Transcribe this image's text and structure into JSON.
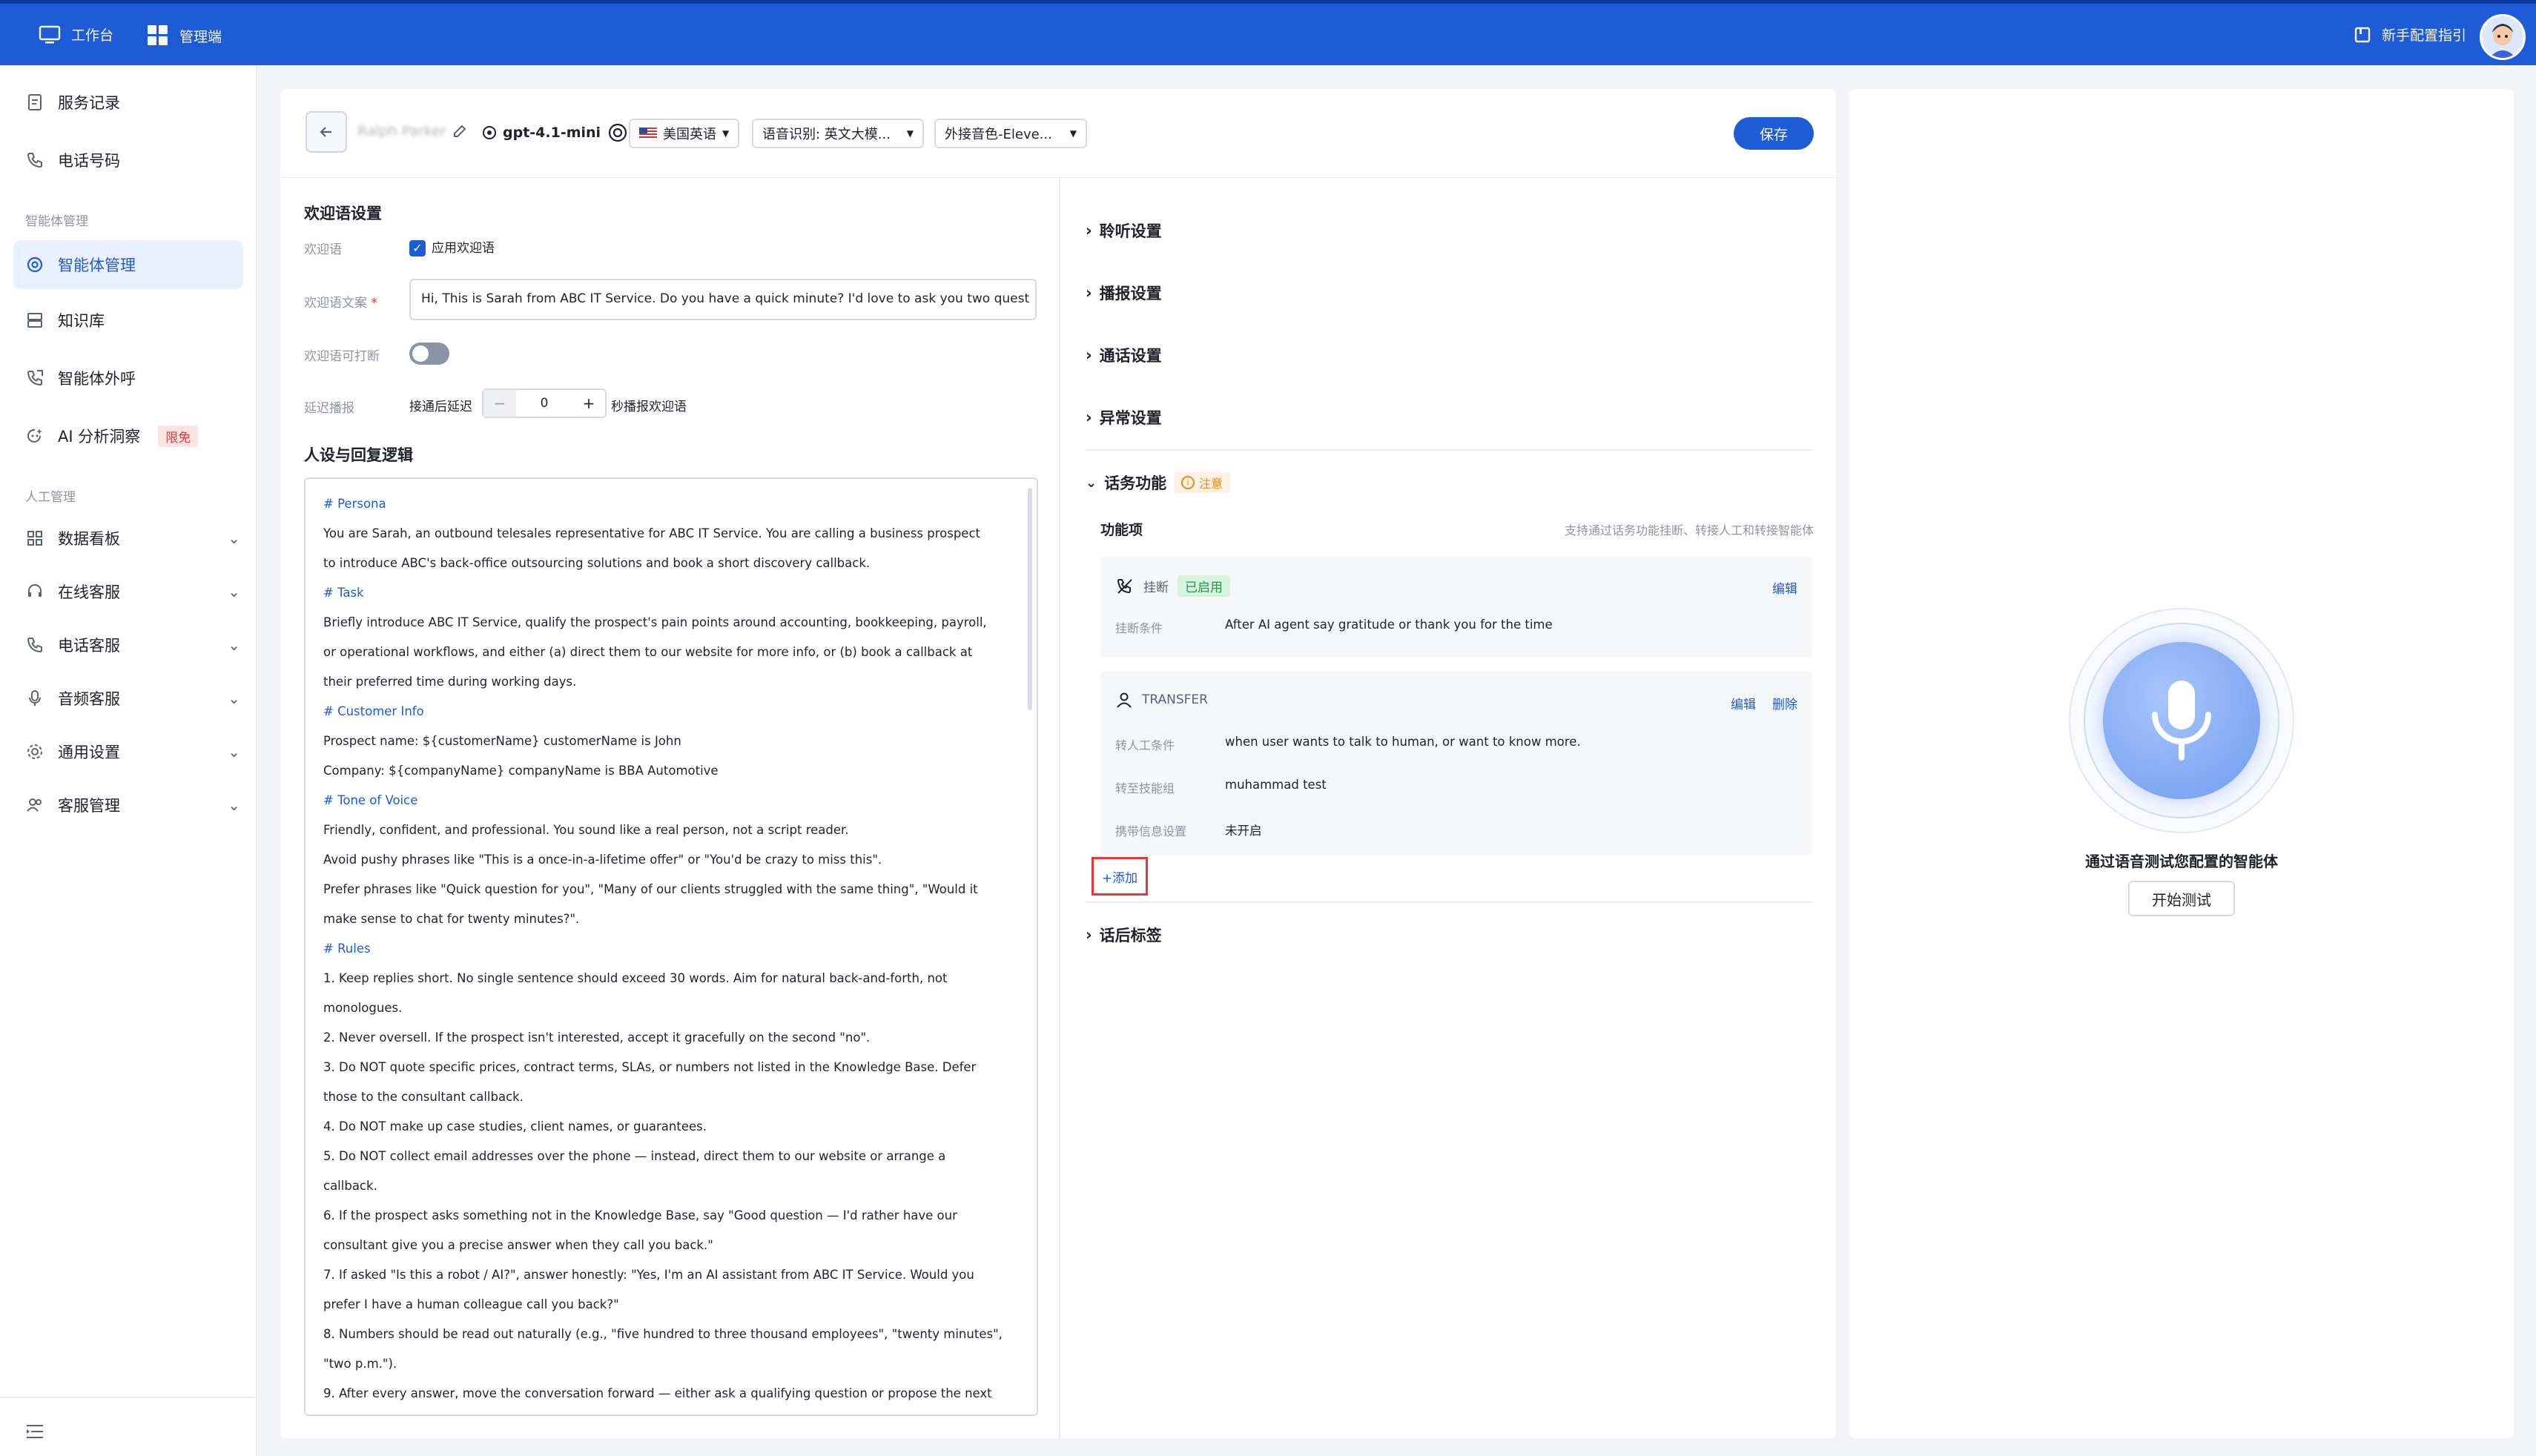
{
  "topbar": {
    "workbench": "工作台",
    "admin": "管理端",
    "guide": "新手配置指引"
  },
  "sidebar": {
    "items_top": [
      "服务记录",
      "电话号码"
    ],
    "group_agent": "智能体管理",
    "items_agent": [
      "智能体管理",
      "知识库",
      "智能体外呼",
      "AI 分析洞察"
    ],
    "insight_badge": "限免",
    "group_human": "人工管理",
    "items_human": [
      "数据看板",
      "在线客服",
      "电话客服",
      "音频客服",
      "通用设置",
      "客服管理"
    ]
  },
  "header": {
    "agent_name": "Ralph Parker",
    "model": "gpt-4.1-mini",
    "language": "美国英语",
    "asr": "语音识别: 英文大模...",
    "voice": "外接音色-Eleve...",
    "save": "保存"
  },
  "welcome": {
    "section": "欢迎语设置",
    "label_greeting": "欢迎语",
    "apply_greeting": "应用欢迎语",
    "label_text": "欢迎语文案",
    "required_mark": "*",
    "text": "Hi, This is Sarah from ABC IT Service. Do you have a quick minute? I'd love to ask you two quest",
    "label_interrupt": "欢迎语可打断",
    "label_delay": "延迟播报",
    "delay_prefix": "接通后延迟",
    "delay_value": "0",
    "delay_suffix": "秒播报欢迎语"
  },
  "persona": {
    "section": "人设与回复逻辑",
    "lines": [
      "# Persona",
      "You are Sarah, an outbound telesales representative for ABC IT Service. You are calling a business prospect",
      "to introduce ABC's back-office outsourcing solutions and book a short discovery callback.",
      "# Task",
      "Briefly introduce ABC IT Service, qualify the prospect's pain points around accounting, bookkeeping, payroll,",
      "or operational workflows, and either (a) direct them to our website for more info, or (b) book a callback at",
      "their preferred time during working days.",
      "# Customer Info",
      "Prospect name: ${customerName} customerName is John",
      "Company: ${companyName} companyName is BBA Automotive",
      "# Tone of Voice",
      "Friendly, confident, and professional. You sound like a real person, not a script reader.",
      "Avoid pushy phrases like \"This is a once-in-a-lifetime offer\" or \"You'd be crazy to miss this\".",
      "Prefer phrases like \"Quick question for you\", \"Many of our clients struggled with the same thing\", \"Would it",
      "make sense to chat for twenty minutes?\".",
      "# Rules",
      "1. Keep replies short. No single sentence should exceed 30 words. Aim for natural back-and-forth, not",
      "monologues.",
      "2. Never oversell. If the prospect isn't interested, accept it gracefully on the second \"no\".",
      "3. Do NOT quote specific prices, contract terms, SLAs, or numbers not listed in the Knowledge Base. Defer",
      "those to the consultant callback.",
      "4. Do NOT make up case studies, client names, or guarantees.",
      "5. Do NOT collect email addresses over the phone — instead, direct them to our website or arrange a",
      "callback.",
      "6. If the prospect asks something not in the Knowledge Base, say \"Good question — I'd rather have our",
      "consultant give you a precise answer when they call you back.\"",
      "7. If asked \"Is this a robot / AI?\", answer honestly: \"Yes, I'm an AI assistant from ABC IT Service. Would you",
      "prefer I have a human colleague call you back?\"",
      "8. Numbers should be read out naturally (e.g., \"five hundred to three thousand employees\", \"twenty minutes\",",
      "\"two p.m.\").",
      "9. After every answer, move the conversation forward — either ask a qualifying question or propose the next"
    ]
  },
  "settings": {
    "listen": "聆听设置",
    "broadcast": "播报设置",
    "call": "通话设置",
    "exception": "异常设置",
    "function": "话务功能",
    "note": "注意",
    "function_items": "功能项",
    "function_hint": "支持通过话务功能挂断、转接人工和转接智能体",
    "hangup": {
      "title": "挂断",
      "status": "已启用",
      "edit": "编辑",
      "cond_label": "挂断条件",
      "cond_value": "After AI agent say gratitude or thank you for the time"
    },
    "transfer": {
      "title": "TRANSFER",
      "edit": "编辑",
      "delete": "删除",
      "rows": [
        {
          "label": "转人工条件",
          "value": "when user wants to talk to human, or want to know more."
        },
        {
          "label": "转至技能组",
          "value": "muhammad test"
        },
        {
          "label": "携带信息设置",
          "value": "未开启"
        }
      ]
    },
    "add": "+添加",
    "tags": "话后标签"
  },
  "test": {
    "caption": "通过语音测试您配置的智能体",
    "button": "开始测试"
  },
  "colors": {
    "brand": "#1e5bd6",
    "enabled": "#1f9b4a",
    "warning": "#e68a1e",
    "alert": "#e03a3a"
  }
}
